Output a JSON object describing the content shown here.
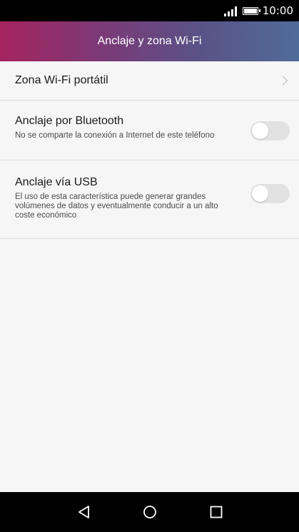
{
  "status_bar": {
    "time": "10:00",
    "icons": [
      "signal-icon",
      "battery-icon"
    ]
  },
  "app_bar": {
    "title": "Anclaje y zona Wi-Fi"
  },
  "items": [
    {
      "title": "Zona Wi-Fi portátil",
      "control": "chevron-right-icon"
    },
    {
      "title": "Anclaje por Bluetooth",
      "subtitle": "No se comparte la conexión a Internet de este teléfono",
      "control": "toggle",
      "enabled": false
    },
    {
      "title": "Anclaje vía USB",
      "subtitle": "El uso de esta característica puede generar grandes volúmenes de datos y eventualmente conducir a un alto coste económico",
      "control": "toggle",
      "enabled": false
    }
  ],
  "colors": {
    "header_gradient_start": "#a5245f",
    "header_gradient_end": "#4f6c98",
    "background": "#f6f6f6",
    "toggle_off": "#e1e1e1"
  },
  "nav_bar": {
    "buttons": [
      "back-icon",
      "home-icon",
      "recent-apps-icon"
    ]
  }
}
